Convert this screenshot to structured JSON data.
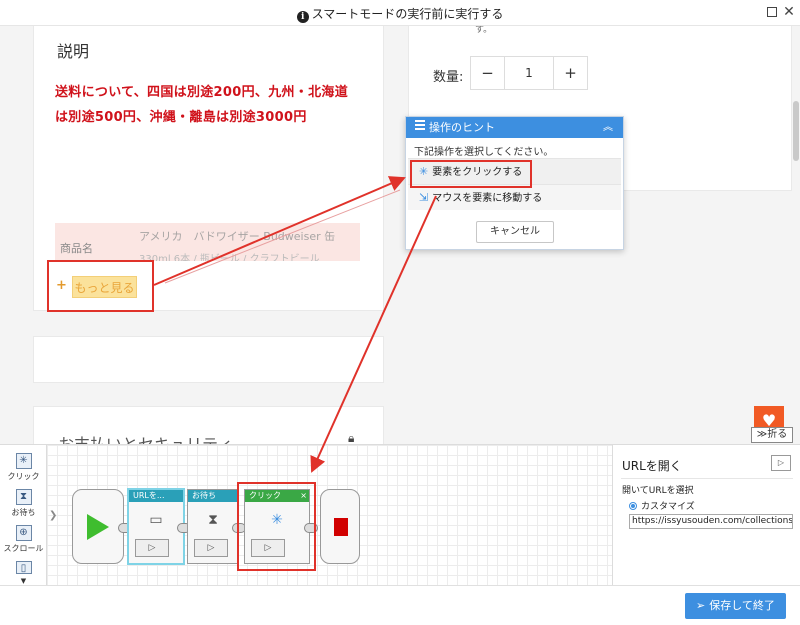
{
  "window": {
    "title": "スマートモードの実行前に実行する"
  },
  "page": {
    "desc_title": "説明",
    "shipping_text": "送料について、四国は別途200円、九州・北海道は別途500円、沖縄・離島は別途3000円",
    "product_label": "商品名",
    "product_name": "アメリカ　バドワイザー Budweiser 缶",
    "product_name_2": "330ml 6本 / 瓶ビール / クラフトビール",
    "more_button": "もっと見る",
    "more_plus": "+",
    "pay_security": "お支払いとセキュリティ",
    "quantity_label": "数量:",
    "quantity_value": "1",
    "quantity_minus": "−",
    "quantity_plus": "+",
    "top_fragment": "す。",
    "fold_label": "≫折る"
  },
  "hint": {
    "title": "操作のヒント",
    "subtitle": "下記操作を選択してください。",
    "options": [
      "要素をクリックする",
      "マウスを要素に移動する"
    ],
    "cancel": "キャンセル"
  },
  "tools": [
    {
      "label": "クリック",
      "icon": "click-icon"
    },
    {
      "label": "お待ち",
      "icon": "hourglass-icon"
    },
    {
      "label": "スクロール",
      "icon": "scroll-icon"
    }
  ],
  "flow": {
    "blocks": [
      {
        "label": "URLを...",
        "icon": "url-icon",
        "color": "#2aa0b8"
      },
      {
        "label": "お待ち",
        "icon": "hourglass-icon",
        "color": "#2aa0b8"
      },
      {
        "label": "クリック",
        "icon": "click-icon",
        "color": "#3aa845"
      }
    ]
  },
  "props": {
    "title": "URLを開く",
    "field_label": "開いてURLを選択",
    "radio_label": "カスタマイズ",
    "url_value": "https://issyusouden.com/collections/%"
  },
  "footer": {
    "save_label": "保存して終了"
  },
  "colors": {
    "accent": "#3d8fe0",
    "highlight": "#e0322a",
    "price_red": "#d0121b"
  }
}
